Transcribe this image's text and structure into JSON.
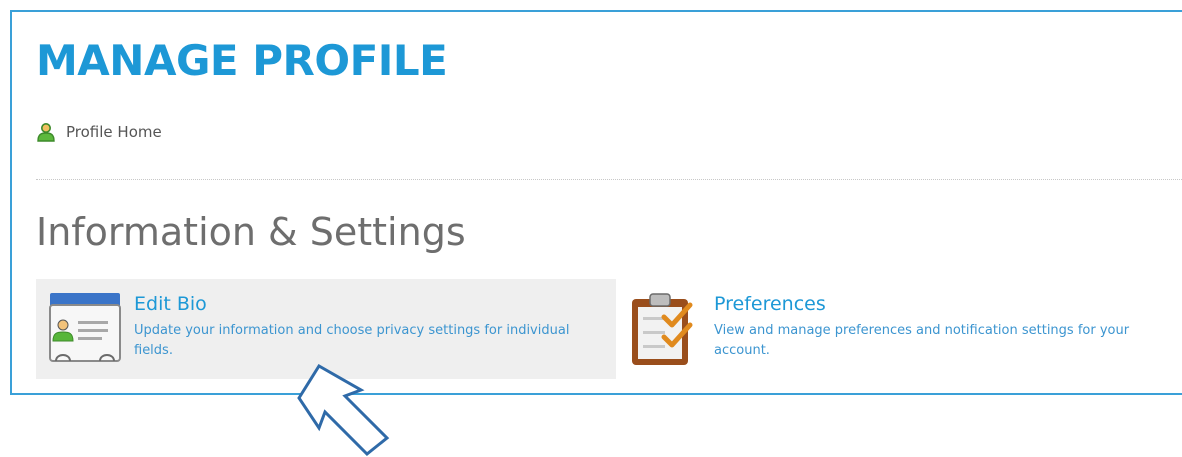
{
  "header": {
    "title": "MANAGE PROFILE"
  },
  "breadcrumb": {
    "label": "Profile Home",
    "icon": "person-icon"
  },
  "section": {
    "title": "Information & Settings"
  },
  "cards": [
    {
      "title": "Edit Bio",
      "description": "Update your information and choose privacy settings for individual fields.",
      "icon": "id-card-icon"
    },
    {
      "title": "Preferences",
      "description": "View and manage preferences and notification settings for your account.",
      "icon": "clipboard-checklist-icon"
    }
  ],
  "colors": {
    "accent": "#1d98d6",
    "frame": "#3aa0d8",
    "arrow": "#2f6aa8"
  }
}
